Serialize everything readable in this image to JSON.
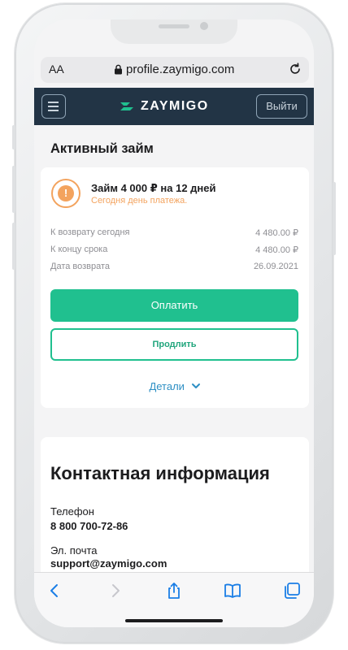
{
  "browser": {
    "aa_label": "AA",
    "url": "profile.zaymigo.com"
  },
  "header": {
    "logo_text": "ZAYMIGO",
    "logout_label": "Выйти",
    "colors": {
      "navbar": "#223445",
      "accent": "#20c08f",
      "warning": "#f3a35e",
      "link": "#2d8fc4"
    }
  },
  "active_loan": {
    "section_title": "Активный займ",
    "title": "Займ 4 000 ₽ на 12 дней",
    "status": "Сегодня день платежа.",
    "rows": [
      {
        "label": "К возврату сегодня",
        "value": "4 480.00 ₽"
      },
      {
        "label": "К концу срока",
        "value": "4 480.00 ₽"
      },
      {
        "label": "Дата возврата",
        "value": "26.09.2021"
      }
    ],
    "pay_label": "Оплатить",
    "extend_label": "Продлить",
    "details_label": "Детали"
  },
  "contacts": {
    "title": "Контактная информация",
    "phone_label": "Телефон",
    "phone_value": "8 800 700-72-86",
    "email_label": "Эл. почта",
    "email_value": "support@zaymigo.com"
  },
  "toolbar": {
    "icons": [
      "back-icon",
      "forward-icon",
      "share-icon",
      "bookmarks-icon",
      "tabs-icon"
    ]
  }
}
